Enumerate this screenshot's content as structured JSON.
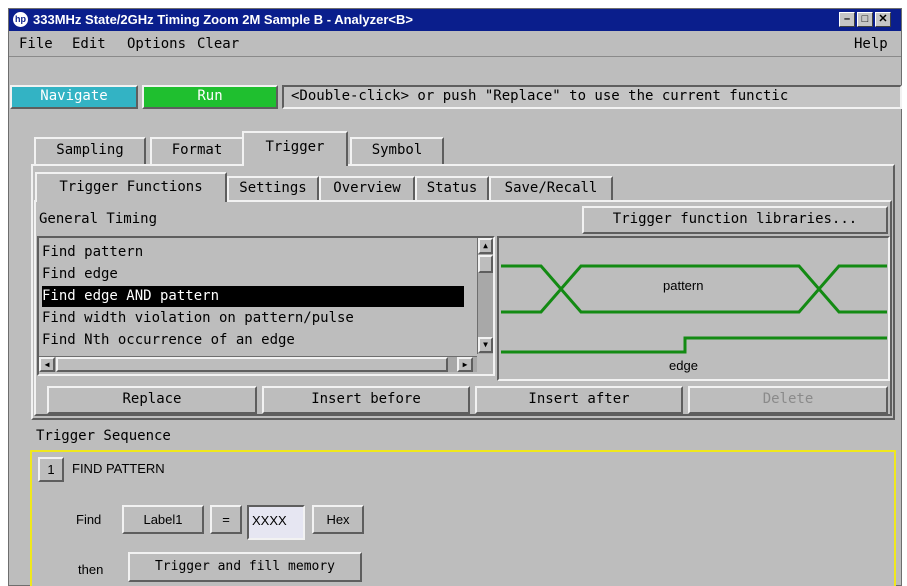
{
  "window": {
    "title": "333MHz State/2GHz Timing Zoom 2M Sample B - Analyzer<B>",
    "logo": "hp"
  },
  "menu": {
    "file": "File",
    "edit": "Edit",
    "options": "Options",
    "clear": "Clear",
    "help": "Help"
  },
  "toolbar": {
    "navigate": "Navigate",
    "run": "Run",
    "message": "<Double-click> or push \"Replace\" to use the current functic",
    "colors": {
      "navigate": "#33b3c4",
      "run": "#1fbf2f"
    }
  },
  "tabs": [
    "Sampling",
    "Format",
    "Trigger",
    "Symbol"
  ],
  "active_tab": "Trigger",
  "subtabs": [
    "Trigger Functions",
    "Settings",
    "Overview",
    "Status",
    "Save/Recall"
  ],
  "active_subtab": "Trigger Functions",
  "functions": {
    "group_label": "General Timing",
    "libraries_button": "Trigger function libraries...",
    "items": [
      "Find pattern",
      "Find edge",
      "Find edge AND pattern",
      "Find width violation on pattern/pulse",
      "Find Nth occurrence of an edge"
    ],
    "selected": "Find edge AND pattern"
  },
  "preview": {
    "pattern_label": "pattern",
    "edge_label": "edge",
    "waveform_color": "#138a13"
  },
  "actions": {
    "replace": "Replace",
    "insert_before": "Insert before",
    "insert_after": "Insert after",
    "delete": "Delete"
  },
  "sequence": {
    "title": "Trigger Sequence",
    "step_number": "1",
    "step_name": "FIND PATTERN",
    "find_label": "Find",
    "label_button": "Label1",
    "operator": "=",
    "value": "XXXX",
    "base": "Hex",
    "then_label": "then",
    "action_button": "Trigger and fill memory",
    "highlight_color": "#f0e81c"
  }
}
